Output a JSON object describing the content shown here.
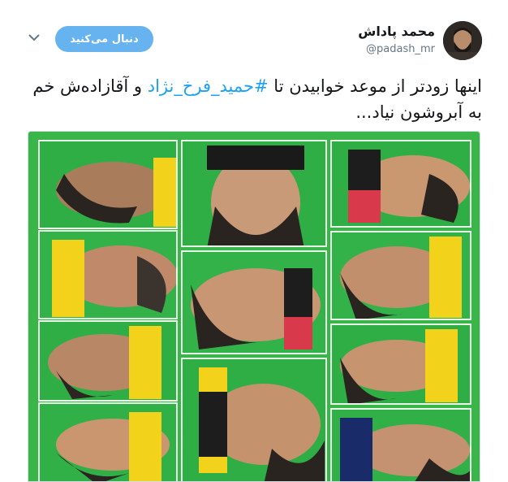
{
  "tweet": {
    "display_name": "محمد پاداش",
    "handle": "@padash_mr",
    "follow_label": "دنبال می‌کنید",
    "text_before": "اینها زودتر از موعد خوابیدن تا ",
    "hashtag": "#حمید_فرخ_نژاد",
    "text_after": " و آقازاده‌ش خم به آبروشون نیاد..."
  },
  "icons": {
    "menu": "chevron-down-icon",
    "avatar": "avatar-image"
  },
  "colors": {
    "follow_button": "#66b3f0",
    "hashtag": "#1da1f2",
    "text": "#14171a",
    "handle": "#657786",
    "shroud": "#39b54a"
  },
  "media": {
    "type": "photo-collage",
    "tiles": 13
  }
}
